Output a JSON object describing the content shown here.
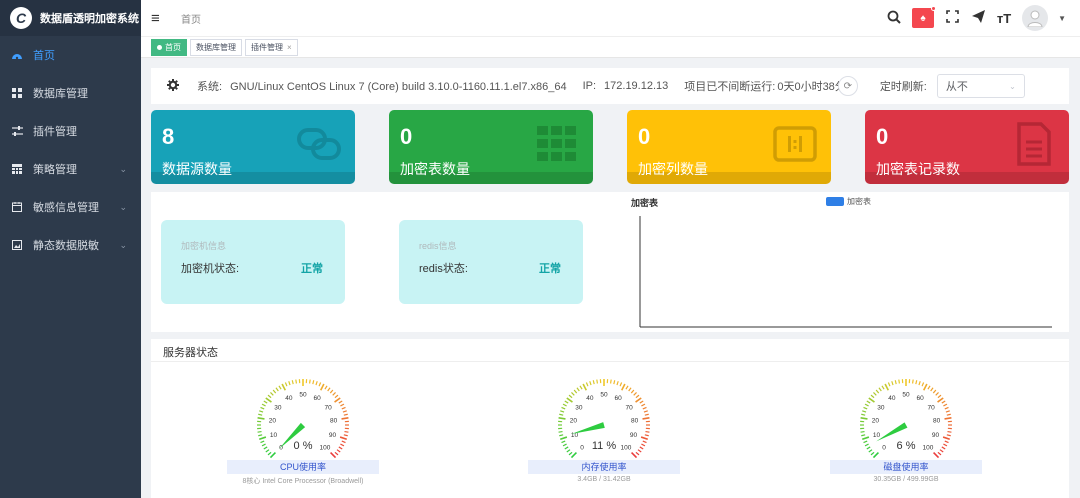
{
  "app": {
    "title": "数据盾透明加密系统",
    "logo_letter": "C"
  },
  "sidebar": {
    "items": [
      {
        "label": "首页",
        "icon": "dashboard-icon",
        "active": true
      },
      {
        "label": "数据库管理",
        "icon": "grid-icon"
      },
      {
        "label": "插件管理",
        "icon": "sliders-icon"
      },
      {
        "label": "策略管理",
        "icon": "table-icon",
        "expandable": true
      },
      {
        "label": "敏感信息管理",
        "icon": "calendar-icon",
        "expandable": true
      },
      {
        "label": "静态数据脱敏",
        "icon": "image-icon",
        "expandable": true
      }
    ]
  },
  "header": {
    "breadcrumb": "首页"
  },
  "tags": [
    {
      "label": "首页",
      "active": true
    },
    {
      "label": "数据库管理"
    },
    {
      "label": "插件管理",
      "closable": true
    }
  ],
  "info": {
    "system_label": "系统:",
    "system_value": "GNU/Linux CentOS Linux 7 (Core) build 3.10.0-1160.11.1.el7.x86_64",
    "ip_label": "IP:",
    "ip_value": "172.19.12.13",
    "uptime_label": "项目已不间断运行:",
    "uptime_value": "0天0小时38分",
    "refresh_label": "定时刷新:",
    "refresh_value": "从不"
  },
  "cards": [
    {
      "value": "8",
      "label": "数据源数量",
      "color": "#17a2b8",
      "icon": "link-icon"
    },
    {
      "value": "0",
      "label": "加密表数量",
      "color": "#28a745",
      "icon": "table-grid-icon"
    },
    {
      "value": "0",
      "label": "加密列数量",
      "color": "#ffc107",
      "icon": "columns-icon"
    },
    {
      "value": "0",
      "label": "加密表记录数",
      "color": "#dc3545",
      "icon": "document-icon"
    }
  ],
  "status": {
    "encryptor": {
      "title": "加密机信息",
      "key": "加密机状态:",
      "value": "正常"
    },
    "redis": {
      "title": "redis信息",
      "key": "redis状态:",
      "value": "正常"
    }
  },
  "chart_data": {
    "type": "bar",
    "title": "加密表",
    "series": [
      {
        "name": "加密表",
        "values": []
      }
    ],
    "categories": [],
    "legend": "top-center"
  },
  "server": {
    "title": "服务器状态",
    "gauges": [
      {
        "name": "CPU使用率",
        "percent": 0,
        "display": "0 %",
        "sub": "8核心 Intel Core Processor (Broadwell)"
      },
      {
        "name": "内存使用率",
        "percent": 11,
        "display": "11 %",
        "sub": "3.4GB / 31.42GB"
      },
      {
        "name": "磁盘使用率",
        "percent": 6,
        "display": "6 %",
        "sub": "30.35GB / 499.99GB"
      }
    ],
    "tick_labels": [
      "0",
      "10",
      "20",
      "30",
      "40",
      "50",
      "60",
      "70",
      "80",
      "90",
      "100"
    ]
  }
}
